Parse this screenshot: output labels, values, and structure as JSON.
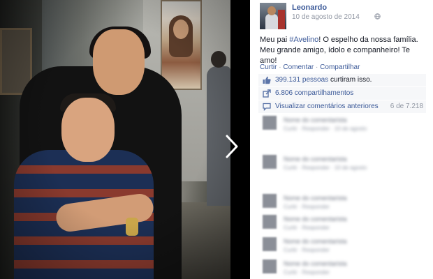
{
  "post": {
    "author": "Leonardo",
    "date": "10 de agosto de 2014",
    "caption_before": "Meu pai ",
    "hashtag": "#Avelino",
    "caption_after": "! O espelho da nossa família. Meu grande amigo, ídolo e companheiro! Te amo!"
  },
  "actions": {
    "like": "Curtir",
    "comment": "Comentar",
    "share": "Compartilhar",
    "separator": "·"
  },
  "stats": {
    "likes_count": "399.131 pessoas",
    "likes_suffix": " curtiram isso.",
    "shares": "6.806 compartilhamentos",
    "view_previous": "Visualizar comentários anteriores",
    "comment_counter": "6 de 7.218"
  },
  "comments": [
    {
      "name": "Nome do comentarista",
      "text": "comentário desfocado",
      "meta": "Curtir · Responder · 10 de agosto"
    },
    {
      "name": "Nome do comentarista",
      "text": "comentário desfocado",
      "meta": "Curtir · Responder · 10 de agosto"
    },
    {
      "name": "Nome do comentarista",
      "text": "comentário desfocado",
      "meta": "Curtir · Responder"
    },
    {
      "name": "Nome do comentarista",
      "text": "",
      "meta": "Curtir · Responder"
    },
    {
      "name": "Nome do comentarista",
      "text": "",
      "meta": "Curtir · Responder"
    },
    {
      "name": "Nome do comentarista",
      "text": "",
      "meta": "Curtir · Responder"
    }
  ],
  "icons": {
    "globe": "globe-icon",
    "like": "thumbs-up-icon",
    "share": "share-icon",
    "comment": "comment-icon",
    "next": "chevron-right-icon"
  },
  "colors": {
    "link": "#3b5998",
    "muted": "#9197a3",
    "panel_bg": "#ffffff",
    "row_bg": "#f6f7f9"
  }
}
